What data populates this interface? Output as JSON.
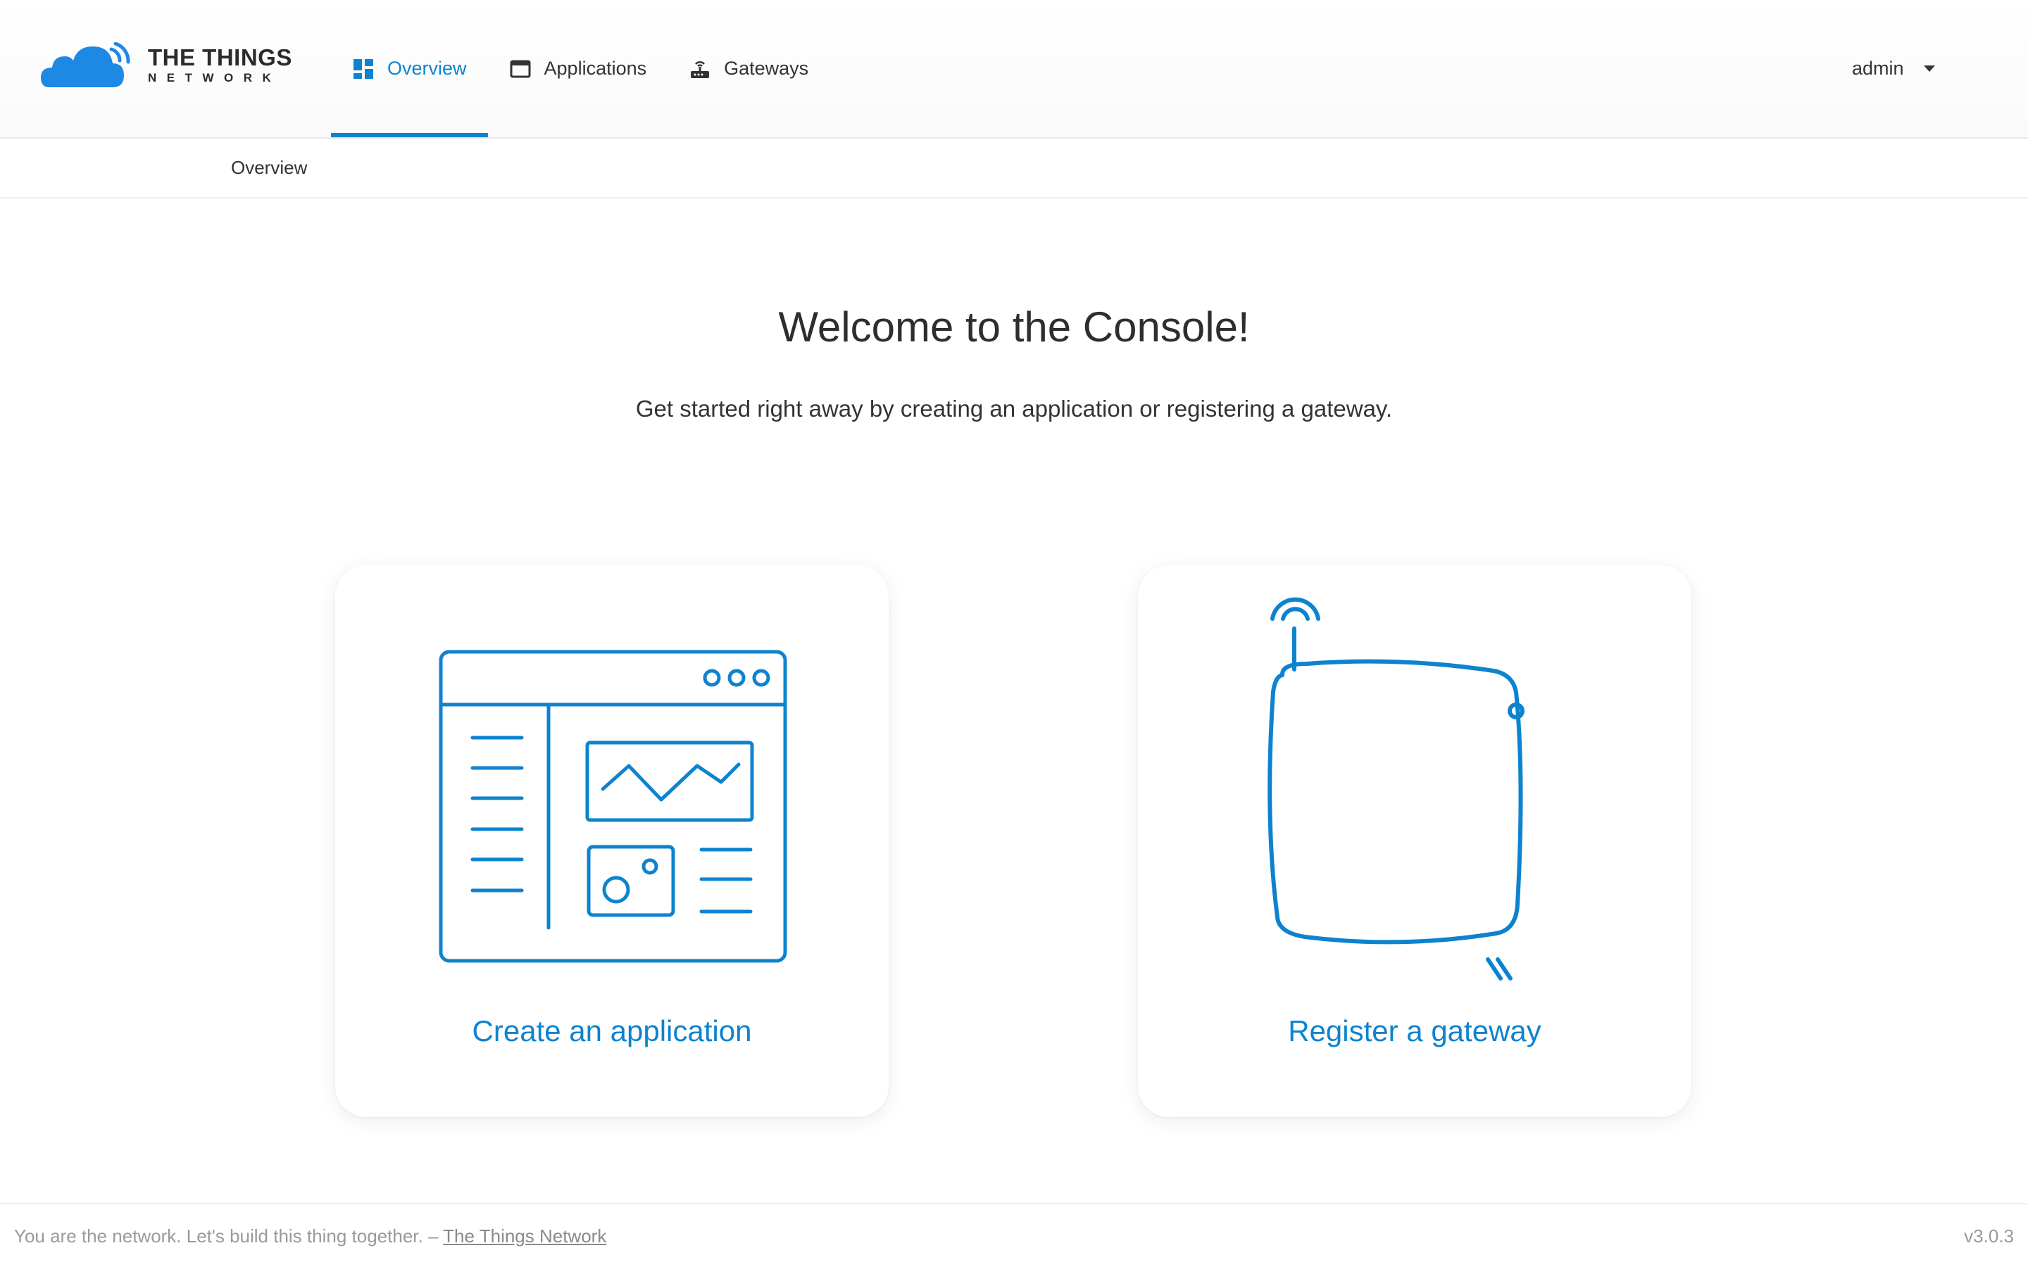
{
  "header": {
    "logo_title": "THE THINGS",
    "logo_subtitle": "NETWORK",
    "nav": [
      {
        "label": "Overview",
        "icon": "dashboard-icon",
        "active": true
      },
      {
        "label": "Applications",
        "icon": "window-icon",
        "active": false
      },
      {
        "label": "Gateways",
        "icon": "router-icon",
        "active": false
      }
    ],
    "user": {
      "name": "admin",
      "icon": "caret-down-icon"
    }
  },
  "breadcrumb": {
    "items": [
      "Overview"
    ]
  },
  "main": {
    "title": "Welcome to the Console!",
    "subtitle": "Get started right away by creating an application or registering a gateway.",
    "cards": [
      {
        "label": "Create an application",
        "icon": "application-illustration-icon"
      },
      {
        "label": "Register a gateway",
        "icon": "gateway-illustration-icon"
      }
    ]
  },
  "footer": {
    "text": "You are the network. Let's build this thing together. – ",
    "link": "The Things Network",
    "version": "v3.0.3"
  },
  "colors": {
    "accent": "#0d83d0",
    "text": "#333333",
    "muted": "#9a9a9a"
  }
}
